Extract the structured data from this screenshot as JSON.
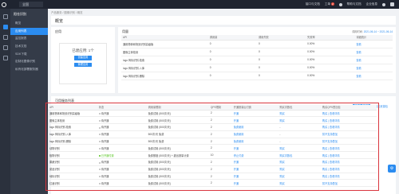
{
  "topbar": {
    "region": "全国",
    "nav": [
      "接口与文档",
      "工单",
      "帮助与文档",
      "企业信息"
    ],
    "badge": "2"
  },
  "sidebar": {
    "title": "阳仓识别",
    "items": [
      {
        "label": "概览",
        "active": false
      },
      {
        "label": "应用列表",
        "active": true
      },
      {
        "label": "监控报表",
        "active": false
      },
      {
        "label": "技术文档",
        "active": false
      },
      {
        "label": "SDK下载",
        "active": false
      },
      {
        "label": "定制化图像识别",
        "active": false
      },
      {
        "label": "私有化部署服务器",
        "active": false
      }
    ]
  },
  "breadcrumb": "产品服务 / 图像识别 / 概览",
  "page_title": "概览",
  "app_card": {
    "title": "应用",
    "status": "已建应用: 1个",
    "create_btn": "创建应用",
    "manage_btn": "管理应用"
  },
  "package_card": {
    "title": "用量",
    "date_label": "调用时间:",
    "date_value": "2021-06-14 ~ 2021-06-14",
    "headers": [
      "API",
      "调用量",
      "调用失败",
      "失败率",
      "详细统计"
    ],
    "rows": [
      [
        "通用物体和场景识别高级版",
        "0",
        "0",
        "0.00%",
        "查看"
      ],
      [
        "图像主体检测",
        "0",
        "0",
        "0.00%",
        "查看"
      ],
      [
        "logo 商标识别-检索",
        "0",
        "0",
        "0.00%",
        "查看"
      ],
      [
        "logo 商标识别-入库",
        "0",
        "0",
        "0.00%",
        "查看"
      ],
      [
        "logo 商标识别-删除",
        "0",
        "0",
        "0.00%",
        "查看"
      ]
    ]
  },
  "list_card": {
    "title": "可用服务列表",
    "btn_add": "领取免费额度",
    "btn_buy": "购买资源包",
    "headers": [
      "API",
      "状态",
      "调用量限制",
      "QPS限制",
      "开通按量后付费",
      "购买次数包",
      "购买QPS叠加包"
    ],
    "rows": [
      [
        "通用物体和场景识别高级版",
        "待开通",
        "免费试用 (500次/天)",
        "2",
        "开通",
        "购买",
        "购买 | 查看详情"
      ],
      [
        "图像主体检测",
        "待开通",
        "免费试用 (500次/天)",
        "2",
        "开通",
        "购买",
        "购买 | 查看详情"
      ],
      [
        "logo 商标识别-检索",
        "待开通",
        "免费试用 (500次/天)",
        "2",
        "免费使用",
        "-",
        "购买 | 查看详情"
      ],
      [
        "logo 商标识别-入库",
        "待开通",
        "500次/天 免费",
        "2",
        "免费使用",
        "-",
        "暂不支持叠加"
      ],
      [
        "logo 商标识别-删除",
        "待开通",
        "500次/天 免费",
        "2",
        "免费使用",
        "-",
        "暂不支持叠加"
      ],
      [
        "动物识别",
        "待开通",
        "免费试用 (500次/天)",
        "2",
        "开通",
        "购买",
        "购买 | 查看详情"
      ],
      [
        "植物识别",
        "已开通付费",
        "免费额度 (500次/天) + 超出按量计费",
        "10",
        "停止付费",
        "购买次数包",
        "购买 | 查看详情"
      ],
      [
        "果蔬识别",
        "待开通",
        "免费试用 (500次/天)",
        "2",
        "开通",
        "购买",
        "购买 | 查看详情"
      ],
      [
        "菜品识别",
        "待开通",
        "免费试用 (500次/天)",
        "2",
        "开通",
        "购买",
        "购买 | 查看详情"
      ],
      [
        "地标识别",
        "待开通",
        "免费试用 (500次/天)",
        "2",
        "开通",
        "购买",
        "购买 | 查看详情"
      ],
      [
        "红酒识别",
        "待开通",
        "免费试用 (500次/天)",
        "2",
        "开通",
        "购买",
        "暂不支持叠加"
      ]
    ]
  },
  "colors": {
    "accent": "#2b8cf0",
    "highlight": "#d9363e",
    "dark": "#1f2430"
  }
}
